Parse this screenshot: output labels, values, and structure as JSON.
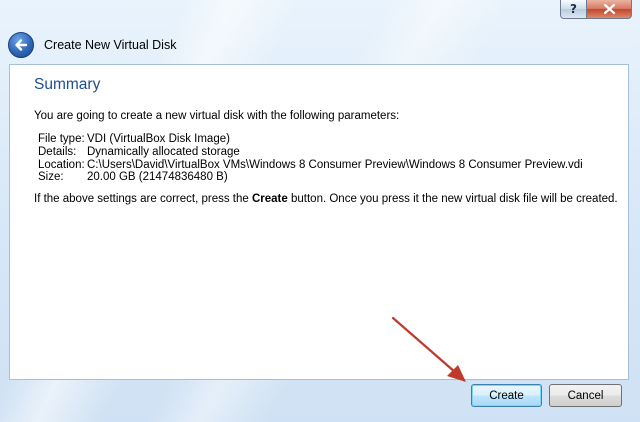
{
  "window": {
    "title": "Create New Virtual Disk",
    "help_label": "?",
    "close_label": "x"
  },
  "summary": {
    "heading": "Summary",
    "intro": "You are going to create a new virtual disk with the following parameters:",
    "details": [
      {
        "label": "File type:",
        "value": "VDI (VirtualBox Disk Image)"
      },
      {
        "label": "Details:",
        "value": "Dynamically allocated storage"
      },
      {
        "label": "Location:",
        "value": "C:\\Users\\David\\VirtualBox VMs\\Windows 8 Consumer Preview\\Windows 8 Consumer Preview.vdi"
      },
      {
        "label": "Size:",
        "value": "20.00 GB (21474836480 B)"
      }
    ],
    "outro_before": "If the above settings are correct, press the ",
    "outro_bold": "Create",
    "outro_after": " button. Once you press it the new virtual disk file will be created."
  },
  "buttons": {
    "create": "Create",
    "cancel": "Cancel"
  },
  "colors": {
    "heading": "#1e4e96",
    "annotation_arrow": "#c0392b"
  },
  "icons": {
    "back": "back-arrow-icon",
    "annotation": "red-pointer-arrow"
  }
}
